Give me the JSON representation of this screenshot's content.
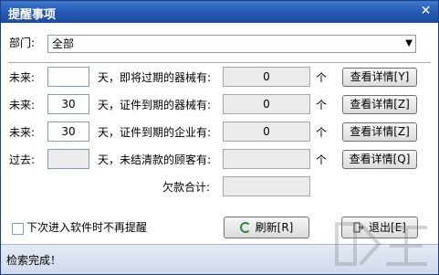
{
  "window": {
    "title": "提醒事项",
    "close": "✕"
  },
  "dept": {
    "label": "部门:",
    "value": "全部"
  },
  "rows": [
    {
      "prefix": "未来:",
      "days": "",
      "desc": "天，即将过期的器械有:",
      "result": "0",
      "unit": "个",
      "button": "查看详情[Y]"
    },
    {
      "prefix": "未来:",
      "days": "30",
      "desc": "天，证件到期的器械有:",
      "result": "0",
      "unit": "个",
      "button": "查看详情[Z]"
    },
    {
      "prefix": "未来:",
      "days": "30",
      "desc": "天，证件到期的企业有:",
      "result": "0",
      "unit": "个",
      "button": "查看详情[Z]"
    },
    {
      "prefix": "过去:",
      "days": "",
      "desc": "天，未结清款的顾客有:",
      "result": "",
      "unit": "个",
      "button": "查看详情[Q]"
    }
  ],
  "total": {
    "label": "欠款合计:",
    "value": ""
  },
  "footer": {
    "checkbox_label": "下次进入软件时不再提醒",
    "refresh_label": "刷新[R]",
    "exit_label": "退出[E]"
  },
  "status": {
    "text": "检索完成！"
  },
  "icons": {
    "refresh": "refresh-icon",
    "exit": "exit-icon",
    "close": "close-icon",
    "dropdown": "chevron-down-icon"
  }
}
